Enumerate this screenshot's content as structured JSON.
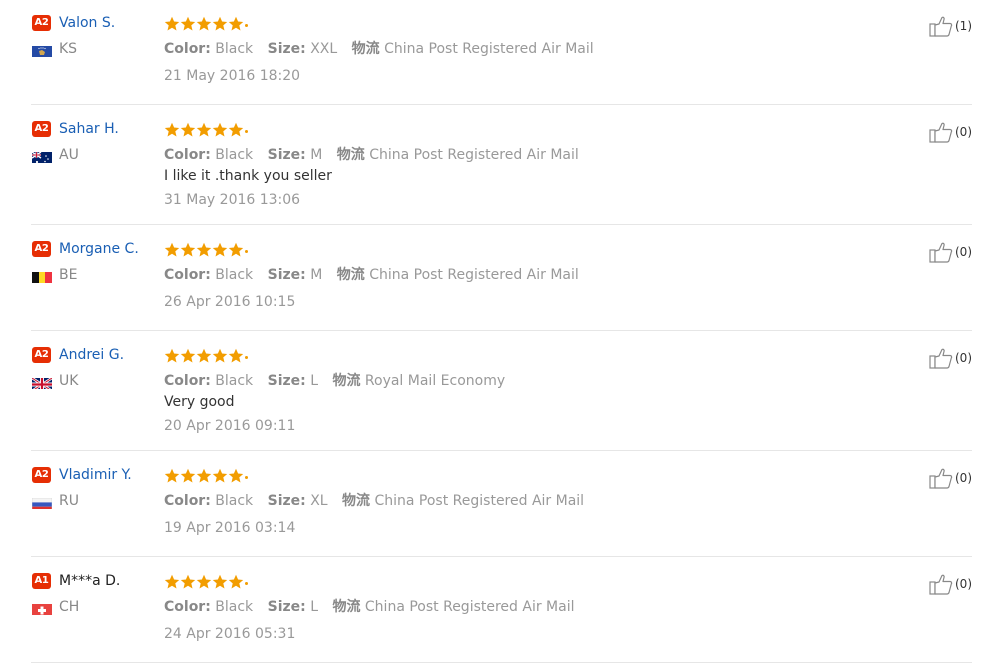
{
  "colors": {
    "a2_badge": "#e62e04",
    "a1_badge": "#e62e04",
    "name_blue": "#1a5fb4",
    "name_dark": "#222222",
    "star": "#f29d00",
    "divider": "#e6e6e6"
  },
  "reviews": [
    {
      "badge": "A2",
      "name": "Valon S.",
      "name_style": "link",
      "country": "KS",
      "flag": "kosovo-flag",
      "rating": 5,
      "color_label": "Color:",
      "color": "Black",
      "size_label": "Size:",
      "size": "XXL",
      "logistics_label": "物流",
      "logistics": "China Post Registered Air Mail",
      "feedback": "",
      "date": "21 May 2016 18:20",
      "helpful": "(1)"
    },
    {
      "badge": "A2",
      "name": "Sahar H.",
      "name_style": "link",
      "country": "AU",
      "flag": "australia-flag",
      "rating": 5,
      "color_label": "Color:",
      "color": "Black",
      "size_label": "Size:",
      "size": "M",
      "logistics_label": "物流",
      "logistics": "China Post Registered Air Mail",
      "feedback": "I like it .thank you seller",
      "date": "31 May 2016 13:06",
      "helpful": "(0)"
    },
    {
      "badge": "A2",
      "name": "Morgane C.",
      "name_style": "link",
      "country": "BE",
      "flag": "belgium-flag",
      "rating": 5,
      "color_label": "Color:",
      "color": "Black",
      "size_label": "Size:",
      "size": "M",
      "logistics_label": "物流",
      "logistics": "China Post Registered Air Mail",
      "feedback": "",
      "date": "26 Apr 2016 10:15",
      "helpful": "(0)"
    },
    {
      "badge": "A2",
      "name": "Andrei G.",
      "name_style": "link",
      "country": "UK",
      "flag": "uk-flag",
      "rating": 5,
      "color_label": "Color:",
      "color": "Black",
      "size_label": "Size:",
      "size": "L",
      "logistics_label": "物流",
      "logistics": "Royal Mail Economy",
      "feedback": "Very good",
      "date": "20 Apr 2016 09:11",
      "helpful": "(0)"
    },
    {
      "badge": "A2",
      "name": "Vladimir Y.",
      "name_style": "link",
      "country": "RU",
      "flag": "russia-flag",
      "rating": 5,
      "color_label": "Color:",
      "color": "Black",
      "size_label": "Size:",
      "size": "XL",
      "logistics_label": "物流",
      "logistics": "China Post Registered Air Mail",
      "feedback": "",
      "date": "19 Apr 2016 03:14",
      "helpful": "(0)"
    },
    {
      "badge": "A1",
      "name": "M***a D.",
      "name_style": "plain",
      "country": "CH",
      "flag": "switzerland-flag",
      "rating": 5,
      "color_label": "Color:",
      "color": "Black",
      "size_label": "Size:",
      "size": "L",
      "logistics_label": "物流",
      "logistics": "China Post Registered Air Mail",
      "feedback": "",
      "date": "24 Apr 2016 05:31",
      "helpful": "(0)"
    }
  ]
}
